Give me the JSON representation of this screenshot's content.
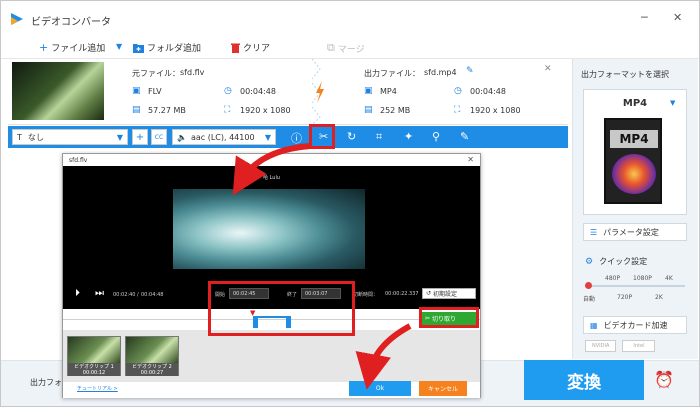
{
  "app": {
    "title": "ビデオコンバータ"
  },
  "toolbar": {
    "add_file": "ファイル追加",
    "add_folder": "フォルダ追加",
    "clear": "クリア",
    "merge": "マージ"
  },
  "file": {
    "source_label": "元ファイル：",
    "source_name": "sfd.flv",
    "source_format": "FLV",
    "source_duration": "00:04:48",
    "source_size": "57.27 MB",
    "source_resolution": "1920 x 1080",
    "output_label": "出力ファイル：",
    "output_name": "sfd.mp4",
    "output_format": "MP4",
    "output_duration": "00:04:48",
    "output_size": "252 MB",
    "output_resolution": "1920 x 1080"
  },
  "editbar": {
    "subtitle": "なし",
    "audio": "aac (LC), 44100"
  },
  "panel": {
    "title": "出力フォーマットを選択",
    "format": "MP4",
    "card_text": "MP4",
    "param_settings": "パラメータ設定",
    "quick_settings": "クイック設定",
    "quality_top": [
      "480P",
      "1080P",
      "4K"
    ],
    "quality_bottom": [
      "自動",
      "720P",
      "2K"
    ],
    "gpu_accel": "ビデオカード加速",
    "nvidia": "NVIDIA",
    "intel": "Intel"
  },
  "bottom": {
    "output_folder": "出力フォ",
    "convert": "変換"
  },
  "dialog": {
    "title": "sfd.flv",
    "overlay_text": "哈 Lulu",
    "current_time": "00:02:40",
    "total_time": "00:04:48",
    "start_label": "開始",
    "start_time": "00:02:45",
    "end_label": "終了",
    "end_time": "00:03:07",
    "clip_duration_label": "切断時間：",
    "clip_duration": "00:00:22.337",
    "reset": "初期設定",
    "cut": "切り取り",
    "clip1_label": "ビデオクリップ 1",
    "clip1_time": "00:00:12",
    "clip2_label": "ビデオクリップ 2",
    "clip2_time": "00:00:27",
    "tutorial": "チュートリアル >",
    "ok": "Ok",
    "cancel": "キャンセル"
  },
  "colors": {
    "accent": "#1f8ce6",
    "highlight": "#e02020",
    "cut_green": "#2fa832",
    "cancel_orange": "#f5821f"
  }
}
